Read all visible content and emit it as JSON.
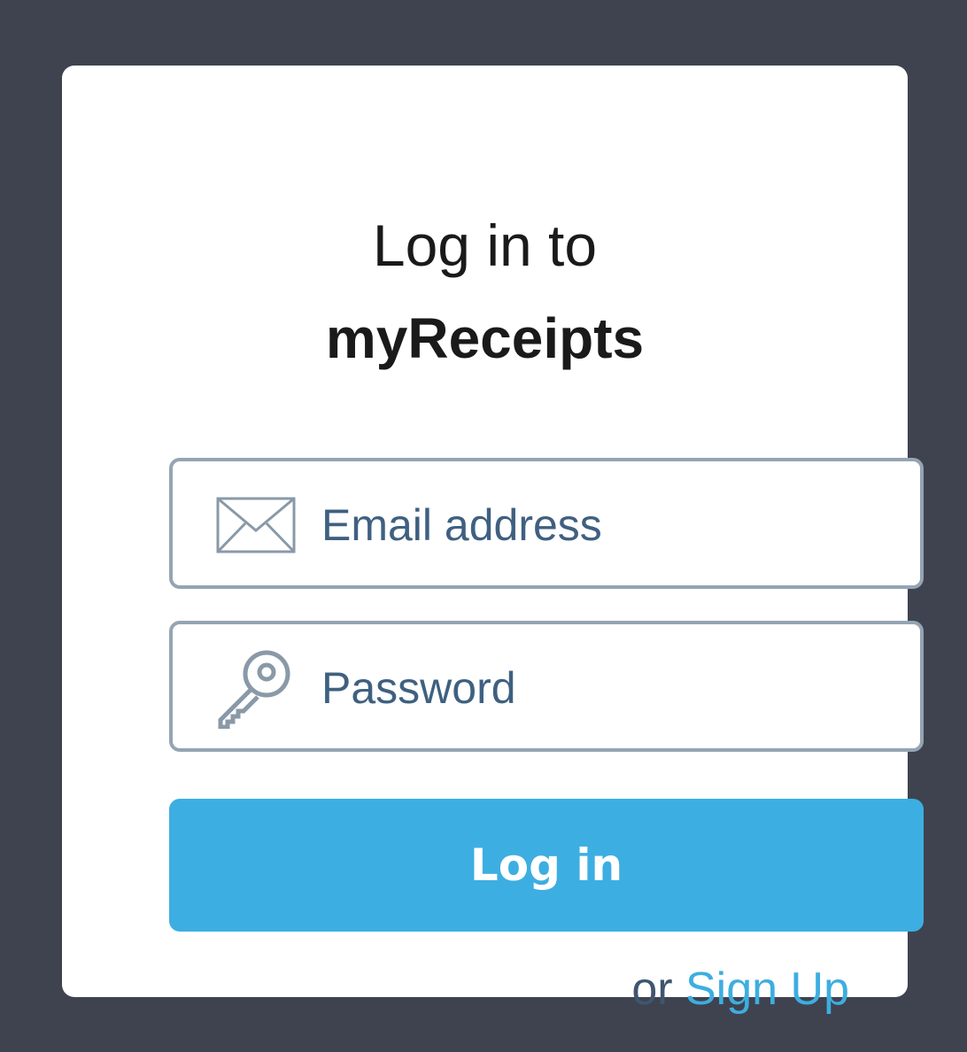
{
  "page": {
    "background_color": "#3f4350",
    "card_color": "#ffffff",
    "accent_color": "#3daee1"
  },
  "header": {
    "title_line1": "Log in to",
    "title_line2": "myReceipts"
  },
  "form": {
    "email": {
      "icon": "envelope-icon",
      "value": "",
      "placeholder": "Email address"
    },
    "password": {
      "icon": "key-icon",
      "value": "",
      "placeholder": "Password"
    },
    "submit_label": "Log in"
  },
  "footer": {
    "or_text": "or",
    "signup_label": "Sign Up"
  }
}
